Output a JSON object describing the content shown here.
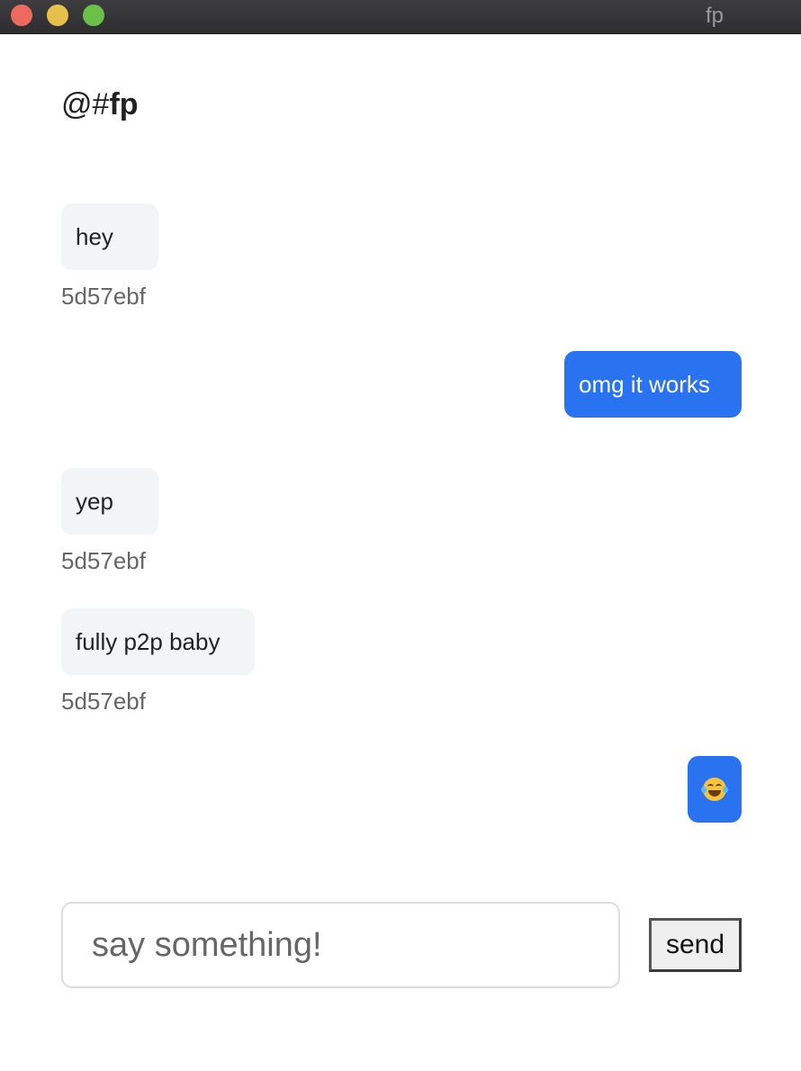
{
  "window": {
    "title": "fp"
  },
  "channel": {
    "prefix": "@#",
    "name": "fp"
  },
  "messages": [
    {
      "text": "hey",
      "direction": "incoming",
      "sender": "5d57ebf"
    },
    {
      "text": "omg it works",
      "direction": "outgoing"
    },
    {
      "text": "yep",
      "direction": "incoming",
      "sender": "5d57ebf"
    },
    {
      "text": "fully p2p baby",
      "direction": "incoming",
      "sender": "5d57ebf"
    },
    {
      "text": "😂",
      "direction": "outgoing",
      "icon": "face-with-tears-of-joy-icon"
    }
  ],
  "composer": {
    "placeholder": "say something!",
    "value": "",
    "send_label": "send"
  },
  "colors": {
    "outgoing_bubble": "#2a73f0",
    "incoming_bubble": "#f3f4f6",
    "sender_text": "#666666"
  }
}
